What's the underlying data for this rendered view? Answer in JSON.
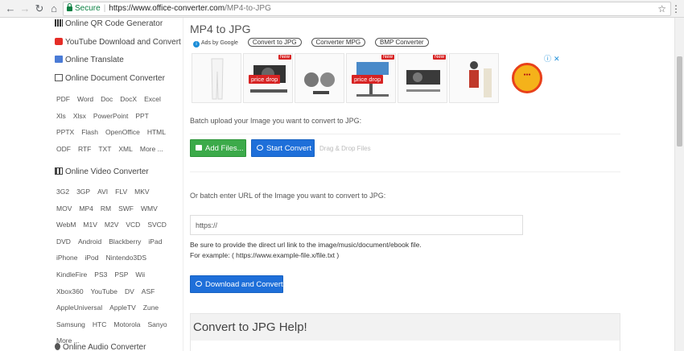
{
  "browser": {
    "secure_label": "Secure",
    "url_host": "https://www.office-converter.com",
    "url_path": "/MP4-to-JPG"
  },
  "sidebar": {
    "qr_title": "Online QR Code Generator",
    "youtube_title": "YouTube Download and Convert",
    "translate_title": "Online Translate",
    "document": {
      "title": "Online Document Converter",
      "links": [
        "PDF",
        "Word",
        "Doc",
        "DocX",
        "Excel",
        "Xls",
        "Xlsx",
        "PowerPoint",
        "PPT",
        "PPTX",
        "Flash",
        "OpenOffice",
        "HTML",
        "ODF",
        "RTF",
        "TXT",
        "XML",
        "More ..."
      ]
    },
    "video": {
      "title": "Online Video Converter",
      "links": [
        "3G2",
        "3GP",
        "AVI",
        "FLV",
        "MKV",
        "MOV",
        "MP4",
        "RM",
        "SWF",
        "WMV",
        "WebM",
        "M1V",
        "M2V",
        "VCD",
        "SVCD",
        "DVD",
        "Android",
        "Blackberry",
        "iPad",
        "iPhone",
        "iPod",
        "Nintendo3DS",
        "KindleFire",
        "PS3",
        "PSP",
        "Wii",
        "Xbox360",
        "YouTube",
        "DV",
        "ASF",
        "AppleUniversal",
        "AppleTV",
        "Zune",
        "Samsung",
        "HTC",
        "Motorola",
        "Sanyo",
        "More ..."
      ]
    },
    "audio_title": "Online Audio Converter"
  },
  "main": {
    "title": "MP4 to JPG",
    "ads_by": "Ads by Google",
    "ad_pills": [
      "Convert to JPG",
      "Converter MPG",
      "BMP Converter"
    ],
    "ad_new_badge": "New",
    "ad_price_drop": "price drop",
    "batch_upload_label": "Batch upload your Image you want to convert to JPG:",
    "add_files": "Add Files...",
    "start_convert": "Start Convert",
    "drag_drop": "Drag & Drop Files",
    "batch_url_label": "Or batch enter URL of the Image you want to convert to JPG:",
    "url_value": "https://",
    "note_line1": "Be sure to provide the direct url link to the image/music/document/ebook file.",
    "note_line2": "For example: ( https://www.example-file.x/file.txt )",
    "download_convert": "Download and Convert",
    "help_title": "Convert to JPG Help!"
  }
}
